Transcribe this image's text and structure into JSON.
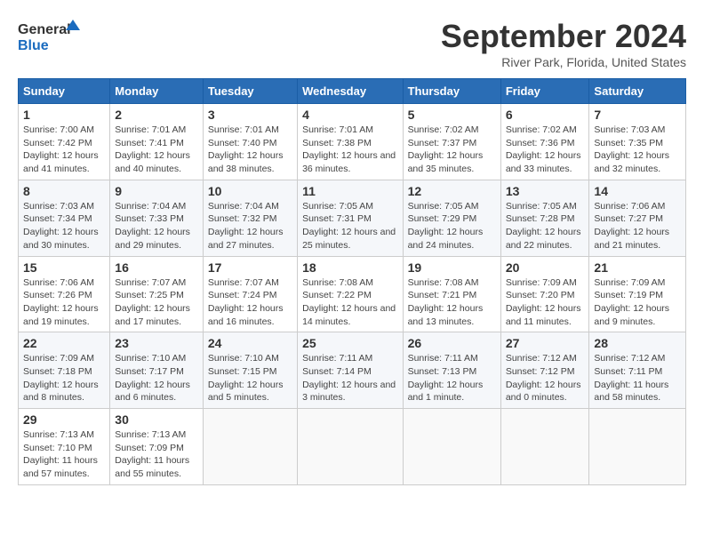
{
  "logo": {
    "text_general": "General",
    "text_blue": "Blue"
  },
  "header": {
    "month_year": "September 2024",
    "location": "River Park, Florida, United States"
  },
  "days_of_week": [
    "Sunday",
    "Monday",
    "Tuesday",
    "Wednesday",
    "Thursday",
    "Friday",
    "Saturday"
  ],
  "weeks": [
    [
      {
        "day": "1",
        "sunrise": "7:00 AM",
        "sunset": "7:42 PM",
        "daylight": "12 hours and 41 minutes."
      },
      {
        "day": "2",
        "sunrise": "7:01 AM",
        "sunset": "7:41 PM",
        "daylight": "12 hours and 40 minutes."
      },
      {
        "day": "3",
        "sunrise": "7:01 AM",
        "sunset": "7:40 PM",
        "daylight": "12 hours and 38 minutes."
      },
      {
        "day": "4",
        "sunrise": "7:01 AM",
        "sunset": "7:38 PM",
        "daylight": "12 hours and 36 minutes."
      },
      {
        "day": "5",
        "sunrise": "7:02 AM",
        "sunset": "7:37 PM",
        "daylight": "12 hours and 35 minutes."
      },
      {
        "day": "6",
        "sunrise": "7:02 AM",
        "sunset": "7:36 PM",
        "daylight": "12 hours and 33 minutes."
      },
      {
        "day": "7",
        "sunrise": "7:03 AM",
        "sunset": "7:35 PM",
        "daylight": "12 hours and 32 minutes."
      }
    ],
    [
      {
        "day": "8",
        "sunrise": "7:03 AM",
        "sunset": "7:34 PM",
        "daylight": "12 hours and 30 minutes."
      },
      {
        "day": "9",
        "sunrise": "7:04 AM",
        "sunset": "7:33 PM",
        "daylight": "12 hours and 29 minutes."
      },
      {
        "day": "10",
        "sunrise": "7:04 AM",
        "sunset": "7:32 PM",
        "daylight": "12 hours and 27 minutes."
      },
      {
        "day": "11",
        "sunrise": "7:05 AM",
        "sunset": "7:31 PM",
        "daylight": "12 hours and 25 minutes."
      },
      {
        "day": "12",
        "sunrise": "7:05 AM",
        "sunset": "7:29 PM",
        "daylight": "12 hours and 24 minutes."
      },
      {
        "day": "13",
        "sunrise": "7:05 AM",
        "sunset": "7:28 PM",
        "daylight": "12 hours and 22 minutes."
      },
      {
        "day": "14",
        "sunrise": "7:06 AM",
        "sunset": "7:27 PM",
        "daylight": "12 hours and 21 minutes."
      }
    ],
    [
      {
        "day": "15",
        "sunrise": "7:06 AM",
        "sunset": "7:26 PM",
        "daylight": "12 hours and 19 minutes."
      },
      {
        "day": "16",
        "sunrise": "7:07 AM",
        "sunset": "7:25 PM",
        "daylight": "12 hours and 17 minutes."
      },
      {
        "day": "17",
        "sunrise": "7:07 AM",
        "sunset": "7:24 PM",
        "daylight": "12 hours and 16 minutes."
      },
      {
        "day": "18",
        "sunrise": "7:08 AM",
        "sunset": "7:22 PM",
        "daylight": "12 hours and 14 minutes."
      },
      {
        "day": "19",
        "sunrise": "7:08 AM",
        "sunset": "7:21 PM",
        "daylight": "12 hours and 13 minutes."
      },
      {
        "day": "20",
        "sunrise": "7:09 AM",
        "sunset": "7:20 PM",
        "daylight": "12 hours and 11 minutes."
      },
      {
        "day": "21",
        "sunrise": "7:09 AM",
        "sunset": "7:19 PM",
        "daylight": "12 hours and 9 minutes."
      }
    ],
    [
      {
        "day": "22",
        "sunrise": "7:09 AM",
        "sunset": "7:18 PM",
        "daylight": "12 hours and 8 minutes."
      },
      {
        "day": "23",
        "sunrise": "7:10 AM",
        "sunset": "7:17 PM",
        "daylight": "12 hours and 6 minutes."
      },
      {
        "day": "24",
        "sunrise": "7:10 AM",
        "sunset": "7:15 PM",
        "daylight": "12 hours and 5 minutes."
      },
      {
        "day": "25",
        "sunrise": "7:11 AM",
        "sunset": "7:14 PM",
        "daylight": "12 hours and 3 minutes."
      },
      {
        "day": "26",
        "sunrise": "7:11 AM",
        "sunset": "7:13 PM",
        "daylight": "12 hours and 1 minute."
      },
      {
        "day": "27",
        "sunrise": "7:12 AM",
        "sunset": "7:12 PM",
        "daylight": "12 hours and 0 minutes."
      },
      {
        "day": "28",
        "sunrise": "7:12 AM",
        "sunset": "7:11 PM",
        "daylight": "11 hours and 58 minutes."
      }
    ],
    [
      {
        "day": "29",
        "sunrise": "7:13 AM",
        "sunset": "7:10 PM",
        "daylight": "11 hours and 57 minutes."
      },
      {
        "day": "30",
        "sunrise": "7:13 AM",
        "sunset": "7:09 PM",
        "daylight": "11 hours and 55 minutes."
      },
      null,
      null,
      null,
      null,
      null
    ]
  ]
}
